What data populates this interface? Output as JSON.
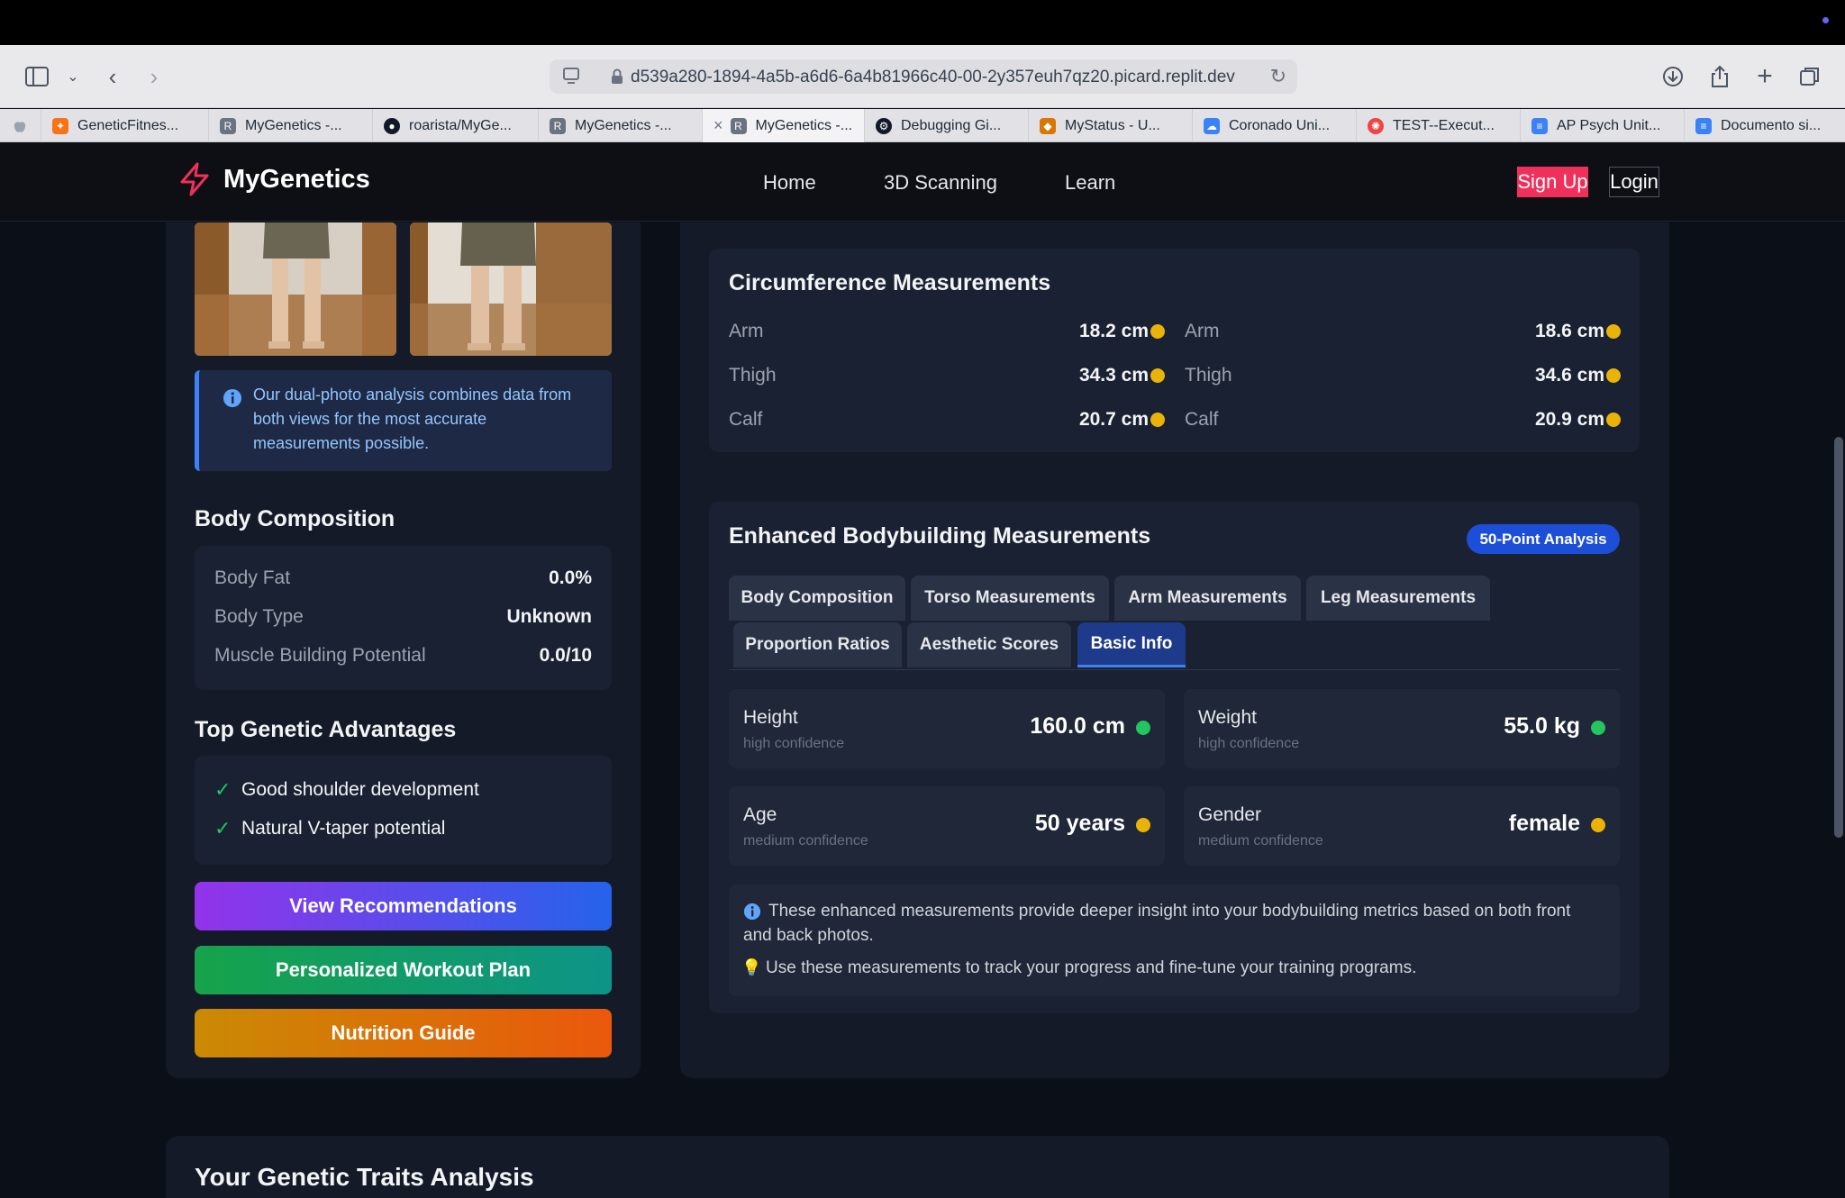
{
  "browser": {
    "url": "d539a280-1894-4a5b-a6d6-6a4b81966c40-00-2y357euh7qz20.picard.replit.dev",
    "tabs": [
      {
        "label": "GeneticFitnes...",
        "icon": "sparkle-icon",
        "color": "#f97316"
      },
      {
        "label": "MyGenetics -...",
        "icon": "replit-r-icon",
        "color": "#6b7280"
      },
      {
        "label": "roarista/MyGe...",
        "icon": "github-icon",
        "color": "#111827"
      },
      {
        "label": "MyGenetics -...",
        "icon": "replit-r-icon",
        "color": "#6b7280"
      },
      {
        "label": "MyGenetics -...",
        "icon": "replit-r-icon",
        "color": "#6b7280"
      },
      {
        "label": "Debugging Gi...",
        "icon": "openai-icon",
        "color": "#111827"
      },
      {
        "label": "MyStatus - U...",
        "icon": "shield-icon",
        "color": "#d97706"
      },
      {
        "label": "Coronado Uni...",
        "icon": "cloud-icon",
        "color": "#3b82f6"
      },
      {
        "label": "TEST--Execut...",
        "icon": "asana-icon",
        "color": "#ef4444"
      },
      {
        "label": "AP Psych Unit...",
        "icon": "docs-icon",
        "color": "#3b82f6"
      },
      {
        "label": "Documento si...",
        "icon": "docs-icon",
        "color": "#3b82f6"
      }
    ]
  },
  "app": {
    "brand": "MyGenetics",
    "nav": [
      "Home",
      "3D Scanning",
      "Learn"
    ],
    "signup": "Sign Up",
    "login": "Login",
    "accent": "#f0305a"
  },
  "left": {
    "info_text": "Our dual-photo analysis combines data from both views for the most accurate measurements possible.",
    "body_comp_title": "Body Composition",
    "body_comp": [
      {
        "label": "Body Fat",
        "value": "0.0%"
      },
      {
        "label": "Body Type",
        "value": "Unknown"
      },
      {
        "label": "Muscle Building Potential",
        "value": "0.0/10"
      }
    ],
    "advantages_title": "Top Genetic Advantages",
    "advantages": [
      "Good shoulder development",
      "Natural V-taper potential"
    ],
    "buttons": {
      "recommendations": "View Recommendations",
      "workout": "Personalized Workout Plan",
      "nutrition": "Nutrition Guide"
    }
  },
  "circumference": {
    "title": "Circumference Measurements",
    "left": [
      {
        "label": "Arm",
        "value": "18.2 cm"
      },
      {
        "label": "Thigh",
        "value": "34.3 cm"
      },
      {
        "label": "Calf",
        "value": "20.7 cm"
      }
    ],
    "right": [
      {
        "label": "Arm",
        "value": "18.6 cm"
      },
      {
        "label": "Thigh",
        "value": "34.6 cm"
      },
      {
        "label": "Calf",
        "value": "20.9 cm"
      }
    ]
  },
  "enhanced": {
    "title": "Enhanced Bodybuilding Measurements",
    "badge": "50-Point Analysis",
    "tabs": [
      "Body Composition",
      "Torso Measurements",
      "Arm Measurements",
      "Leg Measurements",
      "Proportion Ratios",
      "Aesthetic Scores",
      "Basic Info"
    ],
    "active_tab": "Basic Info",
    "metrics": [
      {
        "label": "Height",
        "confidence": "high confidence",
        "value": "160.0 cm",
        "status_color": "#22c55e"
      },
      {
        "label": "Weight",
        "confidence": "high confidence",
        "value": "55.0 kg",
        "status_color": "#22c55e"
      },
      {
        "label": "Age",
        "confidence": "medium confidence",
        "value": "50 years",
        "status_color": "#eab308"
      },
      {
        "label": "Gender",
        "confidence": "medium confidence",
        "value": "female",
        "status_color": "#eab308"
      }
    ],
    "note1": "These enhanced measurements provide deeper insight into your bodybuilding metrics based on both front and back photos.",
    "note2": "Use these measurements to track your progress and fine-tune your training programs."
  },
  "traits": {
    "title": "Your Genetic Traits Analysis"
  }
}
